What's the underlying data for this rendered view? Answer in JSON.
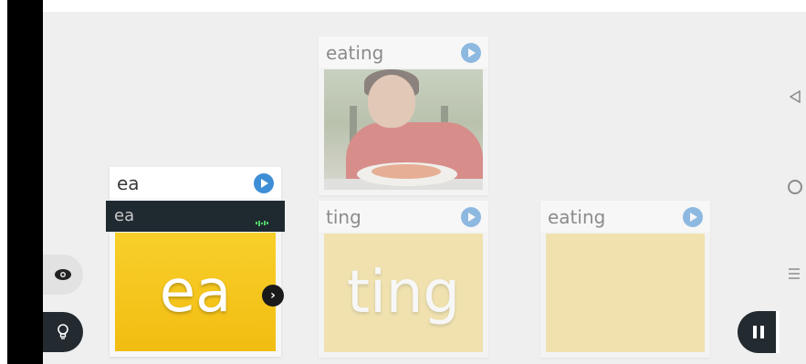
{
  "cards": [
    {
      "label": "eating",
      "type": "image",
      "image_desc": "boy-eating-spaghetti"
    },
    {
      "label": "ea",
      "tile_text": "ea",
      "tile_color": "#f5c520"
    },
    {
      "label": "ting",
      "tile_text": "ting",
      "tile_color": "#f1d77a"
    },
    {
      "label": "eating",
      "tile_text": "",
      "tile_color": "#f1d77a"
    }
  ],
  "overlay": {
    "text": "ea"
  },
  "colors": {
    "play": "#3e8ed6",
    "dark": "#232b30",
    "wave": "#4fcf6a"
  },
  "icons": {
    "play": "play-icon",
    "next": "chevron-right-icon",
    "eye": "eye-icon",
    "bulb": "lightbulb-icon",
    "pause": "pause-icon",
    "back": "back-triangle-icon",
    "home": "home-circle-icon",
    "menu": "menu-lines-icon"
  }
}
